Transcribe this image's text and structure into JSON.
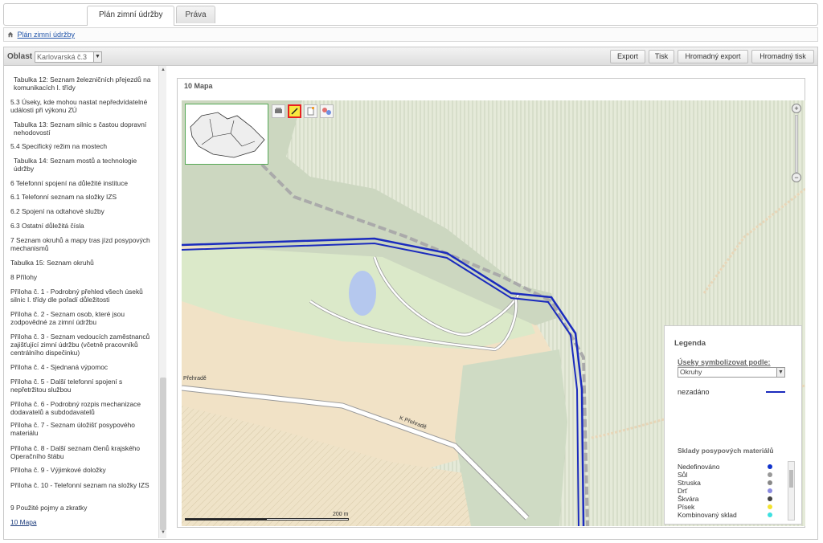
{
  "tabs": [
    {
      "label": "Plán zimní údržby",
      "active": true
    },
    {
      "label": "Práva",
      "active": false
    }
  ],
  "breadcrumb": {
    "home_icon": "home-icon",
    "link": "Plán zimní údržby"
  },
  "toolbar": {
    "oblast_label": "Oblast",
    "oblast_value": "Karlovarská č.3",
    "buttons": [
      "Export",
      "Tisk",
      "Hromadný export",
      "Hromadný tisk"
    ]
  },
  "toc": [
    {
      "label": "Tabulka 12: Seznam železničních přejezdů na komunikacích I. třídy",
      "sub": true
    },
    {
      "label": "5.3 Úseky, kde mohou nastat nepředvídatelné události při výkonu ZÚ",
      "sub": false
    },
    {
      "label": "Tabulka 13: Seznam silnic s častou dopravní nehodovostí",
      "sub": true
    },
    {
      "label": "5.4 Specifický režim na mostech",
      "sub": false
    },
    {
      "label": "Tabulka 14: Seznam mostů a technologie údržby",
      "sub": true
    },
    {
      "label": "6 Telefonní spojení na důležité instituce",
      "sub": false
    },
    {
      "label": "6.1 Telefonní seznam na složky IZS",
      "sub": false
    },
    {
      "label": "6.2 Spojení na odtahové služby",
      "sub": false
    },
    {
      "label": "6.3 Ostatní důležitá čísla",
      "sub": false
    },
    {
      "label": "7 Seznam okruhů a mapy tras jízd posypových mechanismů",
      "sub": false
    },
    {
      "label": "Tabulka 15: Seznam okruhů",
      "sub": false
    },
    {
      "label": "8 Přílohy",
      "sub": false
    },
    {
      "label": "Příloha č. 1 - Podrobný přehled všech úseků silnic I. třídy dle pořadí důležitosti",
      "sub": false
    },
    {
      "label": "Příloha č. 2 - Seznam osob, které jsou zodpovědné za zimní údržbu",
      "sub": false
    },
    {
      "label": "Příloha č. 3 - Seznam vedoucích zaměstnanců zajišťující zimní údržbu (včetně pracovníků centrálního dispečinku)",
      "sub": false
    },
    {
      "label": "Příloha č. 4 - Sjednaná výpomoc",
      "sub": false
    },
    {
      "label": "Příloha č. 5 - Další telefonní spojení s nepřetržitou službou",
      "sub": false
    },
    {
      "label": "Příloha č. 6 - Podrobný rozpis mechanizace dodavatelů a subdodavatelů",
      "sub": false
    },
    {
      "label": "Příloha č. 7 - Seznam úložišť posypového materiálu",
      "sub": false
    },
    {
      "label": "Příloha č. 8 - Další seznam členů krajského Operačního štábu",
      "sub": false
    },
    {
      "label": "Příloha č. 9 - Výjimkové doložky",
      "sub": false
    },
    {
      "label": "Příloha č. 10 - Telefonní seznam na složky IZS",
      "sub": false
    },
    {
      "label": "9 Použité pojmy a zkratky",
      "sub": false
    },
    {
      "label": "10 Mapa",
      "sub": false,
      "link": true
    }
  ],
  "map": {
    "title": "10 Mapa",
    "scale": "200 m",
    "road_labels": [
      "Přehradě",
      "K Přehradě"
    ],
    "tools": [
      "layers-icon",
      "draw-line-icon",
      "note-icon",
      "legend-icon"
    ],
    "zoom_in": "+",
    "zoom_out": "−"
  },
  "legend": {
    "title": "Legenda",
    "symbolize_label": "Úseky symbolizovat podle:",
    "symbolize_value": "Okruhy",
    "unassigned": "nezadáno",
    "unassigned_color": "#1b2bbd",
    "warehouses_title": "Sklady posypových materiálů",
    "warehouses": [
      {
        "label": "Nedefinováno",
        "color": "#1133cc"
      },
      {
        "label": "Sůl",
        "color": "#999999"
      },
      {
        "label": "Struska",
        "color": "#888888"
      },
      {
        "label": "Drť",
        "color": "#8a8ae0"
      },
      {
        "label": "Škvára",
        "color": "#444444"
      },
      {
        "label": "Písek",
        "color": "#f3e230"
      },
      {
        "label": "Kombinovaný sklad",
        "color": "#3de0e0"
      }
    ]
  }
}
